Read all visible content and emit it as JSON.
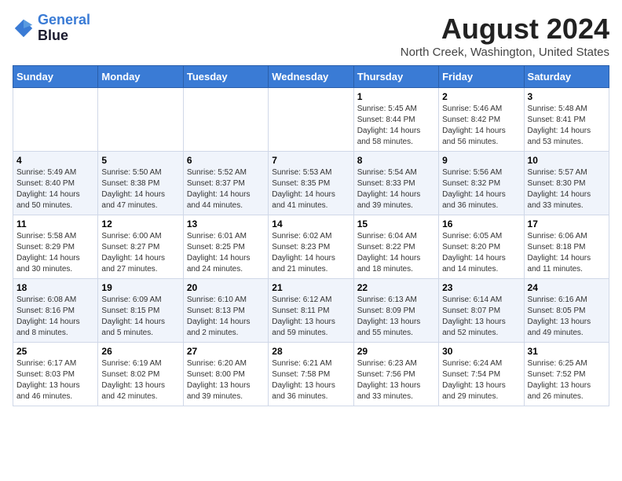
{
  "logo": {
    "line1": "General",
    "line2": "Blue"
  },
  "title": "August 2024",
  "subtitle": "North Creek, Washington, United States",
  "days_of_week": [
    "Sunday",
    "Monday",
    "Tuesday",
    "Wednesday",
    "Thursday",
    "Friday",
    "Saturday"
  ],
  "weeks": [
    [
      {
        "day": "",
        "info": ""
      },
      {
        "day": "",
        "info": ""
      },
      {
        "day": "",
        "info": ""
      },
      {
        "day": "",
        "info": ""
      },
      {
        "day": "1",
        "info": "Sunrise: 5:45 AM\nSunset: 8:44 PM\nDaylight: 14 hours\nand 58 minutes."
      },
      {
        "day": "2",
        "info": "Sunrise: 5:46 AM\nSunset: 8:42 PM\nDaylight: 14 hours\nand 56 minutes."
      },
      {
        "day": "3",
        "info": "Sunrise: 5:48 AM\nSunset: 8:41 PM\nDaylight: 14 hours\nand 53 minutes."
      }
    ],
    [
      {
        "day": "4",
        "info": "Sunrise: 5:49 AM\nSunset: 8:40 PM\nDaylight: 14 hours\nand 50 minutes."
      },
      {
        "day": "5",
        "info": "Sunrise: 5:50 AM\nSunset: 8:38 PM\nDaylight: 14 hours\nand 47 minutes."
      },
      {
        "day": "6",
        "info": "Sunrise: 5:52 AM\nSunset: 8:37 PM\nDaylight: 14 hours\nand 44 minutes."
      },
      {
        "day": "7",
        "info": "Sunrise: 5:53 AM\nSunset: 8:35 PM\nDaylight: 14 hours\nand 41 minutes."
      },
      {
        "day": "8",
        "info": "Sunrise: 5:54 AM\nSunset: 8:33 PM\nDaylight: 14 hours\nand 39 minutes."
      },
      {
        "day": "9",
        "info": "Sunrise: 5:56 AM\nSunset: 8:32 PM\nDaylight: 14 hours\nand 36 minutes."
      },
      {
        "day": "10",
        "info": "Sunrise: 5:57 AM\nSunset: 8:30 PM\nDaylight: 14 hours\nand 33 minutes."
      }
    ],
    [
      {
        "day": "11",
        "info": "Sunrise: 5:58 AM\nSunset: 8:29 PM\nDaylight: 14 hours\nand 30 minutes."
      },
      {
        "day": "12",
        "info": "Sunrise: 6:00 AM\nSunset: 8:27 PM\nDaylight: 14 hours\nand 27 minutes."
      },
      {
        "day": "13",
        "info": "Sunrise: 6:01 AM\nSunset: 8:25 PM\nDaylight: 14 hours\nand 24 minutes."
      },
      {
        "day": "14",
        "info": "Sunrise: 6:02 AM\nSunset: 8:23 PM\nDaylight: 14 hours\nand 21 minutes."
      },
      {
        "day": "15",
        "info": "Sunrise: 6:04 AM\nSunset: 8:22 PM\nDaylight: 14 hours\nand 18 minutes."
      },
      {
        "day": "16",
        "info": "Sunrise: 6:05 AM\nSunset: 8:20 PM\nDaylight: 14 hours\nand 14 minutes."
      },
      {
        "day": "17",
        "info": "Sunrise: 6:06 AM\nSunset: 8:18 PM\nDaylight: 14 hours\nand 11 minutes."
      }
    ],
    [
      {
        "day": "18",
        "info": "Sunrise: 6:08 AM\nSunset: 8:16 PM\nDaylight: 14 hours\nand 8 minutes."
      },
      {
        "day": "19",
        "info": "Sunrise: 6:09 AM\nSunset: 8:15 PM\nDaylight: 14 hours\nand 5 minutes."
      },
      {
        "day": "20",
        "info": "Sunrise: 6:10 AM\nSunset: 8:13 PM\nDaylight: 14 hours\nand 2 minutes."
      },
      {
        "day": "21",
        "info": "Sunrise: 6:12 AM\nSunset: 8:11 PM\nDaylight: 13 hours\nand 59 minutes."
      },
      {
        "day": "22",
        "info": "Sunrise: 6:13 AM\nSunset: 8:09 PM\nDaylight: 13 hours\nand 55 minutes."
      },
      {
        "day": "23",
        "info": "Sunrise: 6:14 AM\nSunset: 8:07 PM\nDaylight: 13 hours\nand 52 minutes."
      },
      {
        "day": "24",
        "info": "Sunrise: 6:16 AM\nSunset: 8:05 PM\nDaylight: 13 hours\nand 49 minutes."
      }
    ],
    [
      {
        "day": "25",
        "info": "Sunrise: 6:17 AM\nSunset: 8:03 PM\nDaylight: 13 hours\nand 46 minutes."
      },
      {
        "day": "26",
        "info": "Sunrise: 6:19 AM\nSunset: 8:02 PM\nDaylight: 13 hours\nand 42 minutes."
      },
      {
        "day": "27",
        "info": "Sunrise: 6:20 AM\nSunset: 8:00 PM\nDaylight: 13 hours\nand 39 minutes."
      },
      {
        "day": "28",
        "info": "Sunrise: 6:21 AM\nSunset: 7:58 PM\nDaylight: 13 hours\nand 36 minutes."
      },
      {
        "day": "29",
        "info": "Sunrise: 6:23 AM\nSunset: 7:56 PM\nDaylight: 13 hours\nand 33 minutes."
      },
      {
        "day": "30",
        "info": "Sunrise: 6:24 AM\nSunset: 7:54 PM\nDaylight: 13 hours\nand 29 minutes."
      },
      {
        "day": "31",
        "info": "Sunrise: 6:25 AM\nSunset: 7:52 PM\nDaylight: 13 hours\nand 26 minutes."
      }
    ]
  ]
}
